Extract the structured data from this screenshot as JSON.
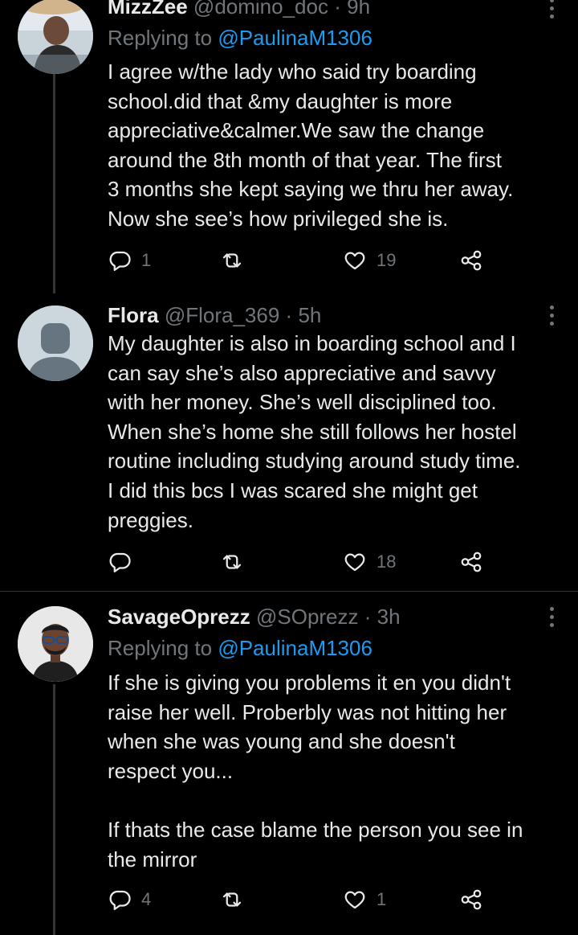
{
  "tweets": [
    {
      "name": "MizzZee",
      "handle": "@domino_doc",
      "sep": "·",
      "time": "9h",
      "replying_prefix": "Replying to ",
      "replying_to": "@PaulinaM1306",
      "text": "I agree w/the lady who said try boarding\nschool.did that &my daughter is more\nappreciative&calmer.We saw the change\naround the 8th month of that year. The first\n3 months she kept saying we thru her away.\nNow she see’s how privileged she is.",
      "replies": "1",
      "retweets": "",
      "likes": "19"
    },
    {
      "name": "Flora",
      "handle": "@Flora_369",
      "sep": "·",
      "time": "5h",
      "text": "My daughter is also in boarding school and I\ncan say she’s also appreciative and savvy\nwith her money. She’s well disciplined too.\nWhen she’s home she still follows her hostel\nroutine including studying around study time.\nI did this bcs I was scared she might get\npreggies.",
      "replies": "",
      "retweets": "",
      "likes": "18"
    },
    {
      "name": "SavageOprezz",
      "handle": "@SOprezz",
      "sep": "·",
      "time": "3h",
      "replying_prefix": "Replying to ",
      "replying_to": "@PaulinaM1306",
      "text": "If she is giving you problems it en you didn't\nraise her well. Proberbly was not hitting her\nwhen she was young and she doesn't\nrespect you...\n\nIf thats the case blame the person you see in\nthe mirror",
      "replies": "4",
      "retweets": "",
      "likes": "1"
    }
  ],
  "icons": {
    "reply": "reply-icon",
    "retweet": "retweet-icon",
    "like": "heart-icon",
    "share": "share-icon",
    "more": "more-options-icon"
  },
  "colors": {
    "background": "#000000",
    "text": "#e7e9ea",
    "muted": "#71767b",
    "link": "#1d9bf0"
  }
}
